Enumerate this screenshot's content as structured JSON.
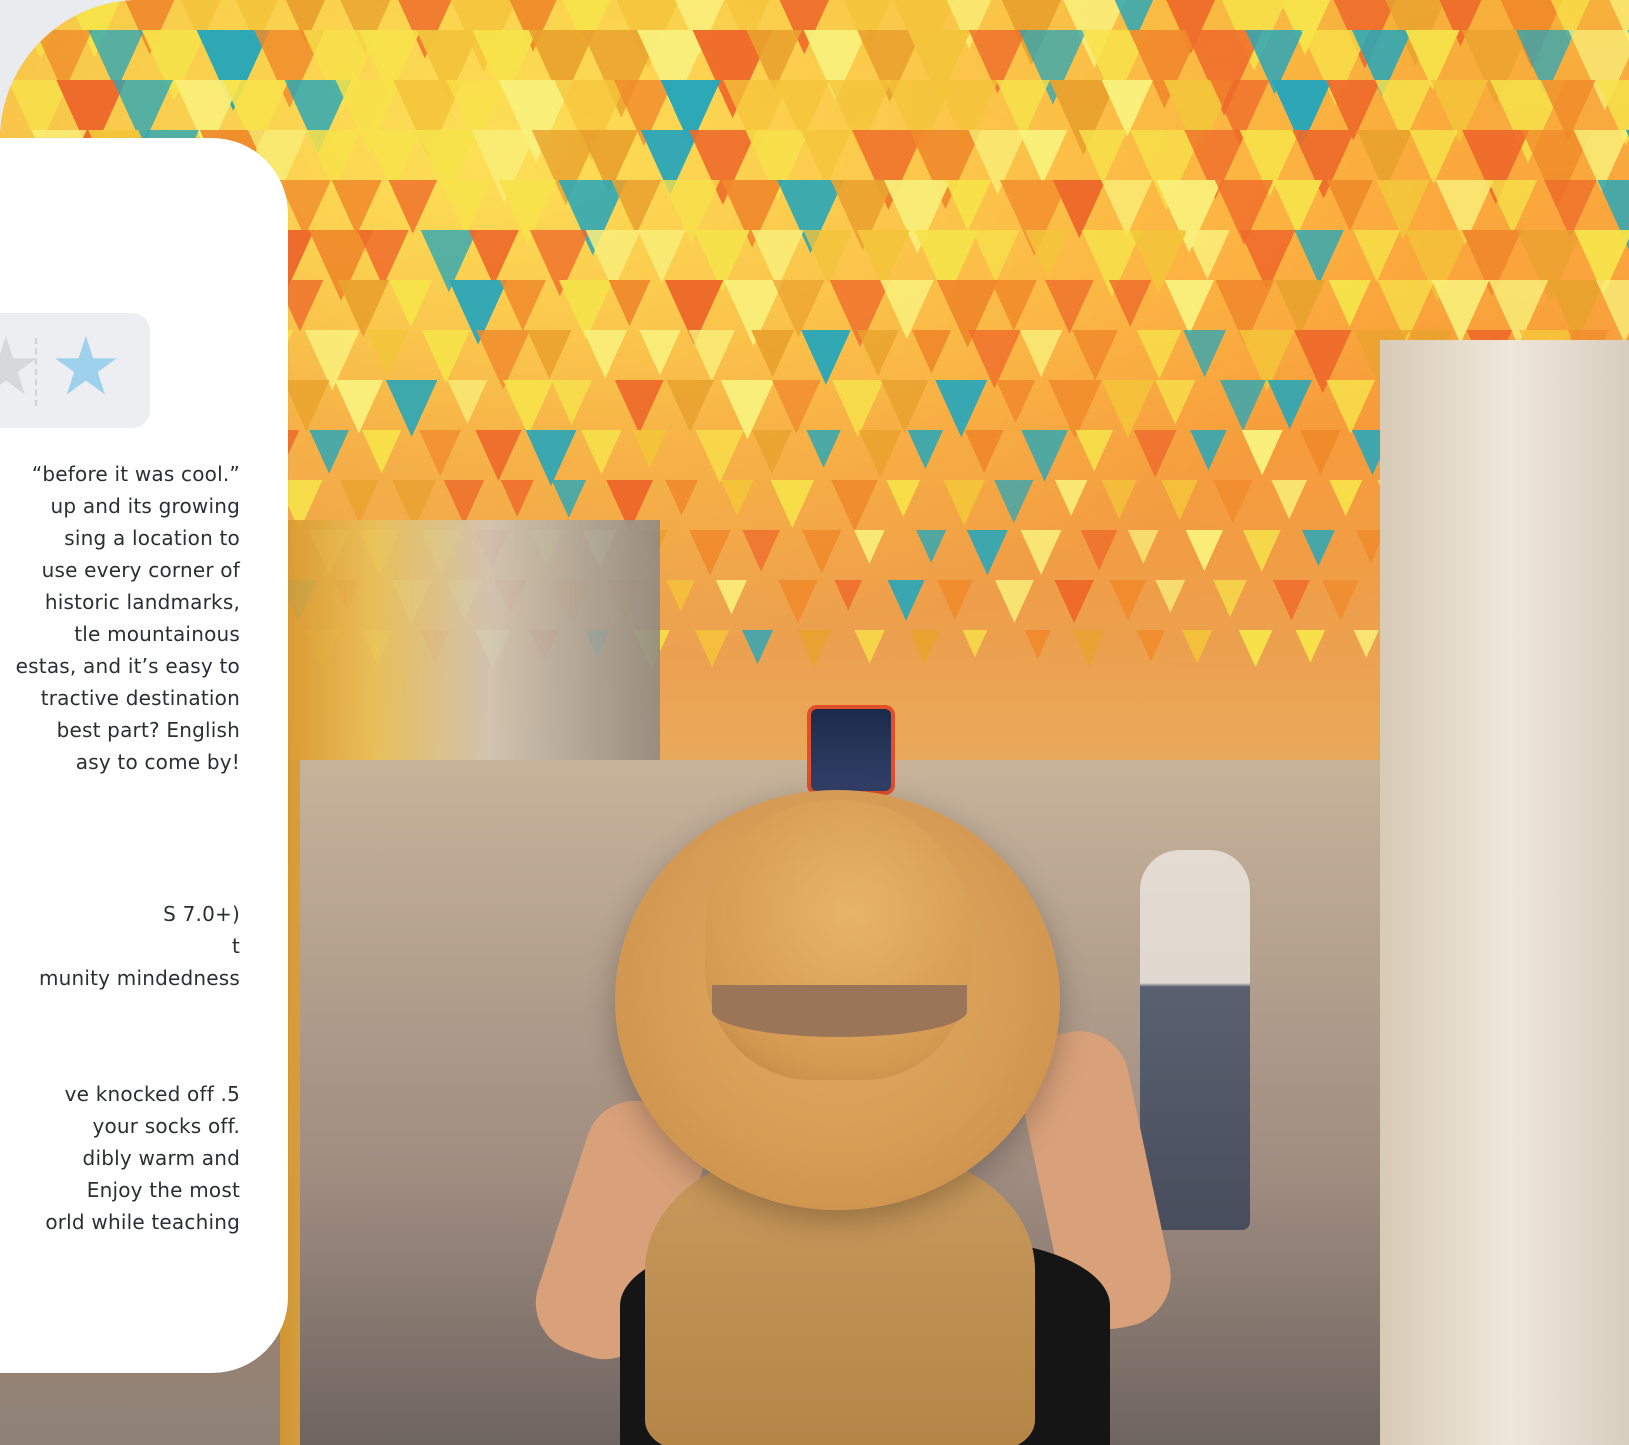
{
  "rating": {
    "stars": [
      "star",
      "star"
    ],
    "colors": {
      "inactive": "#d6d8dc",
      "active": "#9dd1ec"
    }
  },
  "paragraphs": {
    "intro": [
      "“before it was cool.”",
      "up and its growing",
      "sing a location to",
      "use every corner of",
      "historic landmarks,",
      "tle mountainous",
      "estas, and it’s easy to",
      "tractive destination",
      "best part? English",
      "asy to come by!"
    ],
    "list": [
      "S 7.0+)",
      "t",
      "munity mindedness"
    ],
    "closing": [
      "ve knocked off .5",
      "your socks off.",
      "dibly warm and",
      "Enjoy the most",
      "orld while teaching"
    ]
  }
}
